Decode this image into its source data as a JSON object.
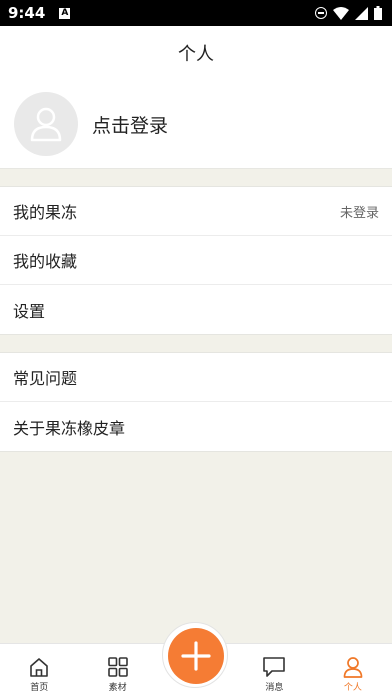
{
  "status_bar": {
    "time": "9:44",
    "notification_glyph": "A"
  },
  "header": {
    "title": "个人"
  },
  "profile": {
    "login_label": "点击登录"
  },
  "menu_group_1": [
    {
      "label": "我的果冻",
      "value": "未登录"
    },
    {
      "label": "我的收藏",
      "value": ""
    },
    {
      "label": "设置",
      "value": ""
    }
  ],
  "menu_group_2": [
    {
      "label": "常见问题"
    },
    {
      "label": "关于果冻橡皮章"
    }
  ],
  "tabbar": {
    "home": "首页",
    "materials": "素材",
    "messages": "消息",
    "profile": "个人"
  },
  "colors": {
    "accent": "#f57c34",
    "background": "#f2f1e9"
  }
}
